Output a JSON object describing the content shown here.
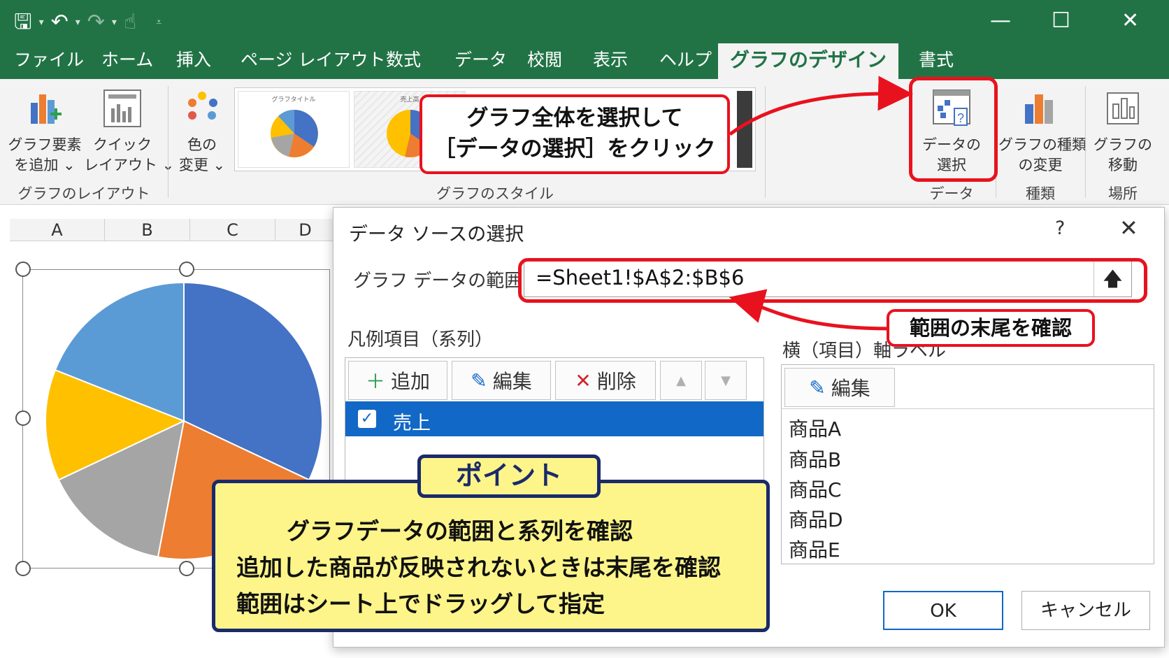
{
  "titlebar": {
    "controls": {
      "minimize": "—",
      "maximize": "☐",
      "close": "✕"
    },
    "qat_icons": [
      "save-icon",
      "undo-icon",
      "redo-icon",
      "touch-mode-icon",
      "customize-qat-icon"
    ],
    "accent": "#217346"
  },
  "tabs": [
    "ファイル",
    "ホーム",
    "挿入",
    "ページ レイアウト",
    "数式",
    "データ",
    "校閲",
    "表示",
    "ヘルプ",
    "グラフのデザイン",
    "書式"
  ],
  "active_tab": "グラフのデザイン",
  "ribbon": {
    "add_element": "グラフ要素\nを追加 ⌄",
    "quick_layout": "クイック\nレイアウト ⌄",
    "change_colors": "色の\n変更 ⌄",
    "group_layout": "グラフのレイアウト",
    "gallery_thumb1": "グラフタイトル",
    "gallery_thumb2": "売上高",
    "group_styles": "グラフのスタイル",
    "select_data": "データの\n選択",
    "group_data": "データ",
    "change_type": "グラフの種類\nの変更",
    "group_type": "種類",
    "move_chart": "グラフの\n移動",
    "group_location": "場所"
  },
  "sheet": {
    "columns": [
      "A",
      "B",
      "C",
      "D"
    ]
  },
  "chart_data": {
    "type": "pie",
    "categories": [
      "商品A",
      "商品B",
      "商品C",
      "商品D",
      "商品E"
    ],
    "values": [
      32,
      21,
      15,
      13,
      19
    ],
    "colors": [
      "#4472c4",
      "#ed7d31",
      "#a5a5a5",
      "#ffc000",
      "#5b9bd5"
    ]
  },
  "dialog": {
    "title": "データ ソースの選択",
    "help": "?",
    "close": "✕",
    "range_label": "グラフ データの範囲:",
    "range_value": "=Sheet1!$A$2:$B$6",
    "range_button": "🡅",
    "series_label": "凡例項目（系列）",
    "add": "追加",
    "edit": "編集",
    "delete": "削除",
    "series": [
      "売上"
    ],
    "axis_label": "横（項目）軸ラベル",
    "axis_edit": "編集",
    "categories": [
      "商品A",
      "商品B",
      "商品C",
      "商品D",
      "商品E"
    ],
    "ok": "OK",
    "cancel": "キャンセル"
  },
  "callouts": {
    "select_data_line1": "グラフ全体を選択して",
    "select_data_line2": "［データの選択］をクリック",
    "range_end": "範囲の末尾を確認",
    "point_tag": "ポイント",
    "point_lines": [
      "グラフデータの範囲と系列を確認",
      "追加した商品が反映されないときは末尾を確認",
      "範囲はシート上でドラッグして指定"
    ],
    "red": "#e8121e",
    "yellow": "#fdf58a",
    "navy": "#1a2a6a"
  }
}
